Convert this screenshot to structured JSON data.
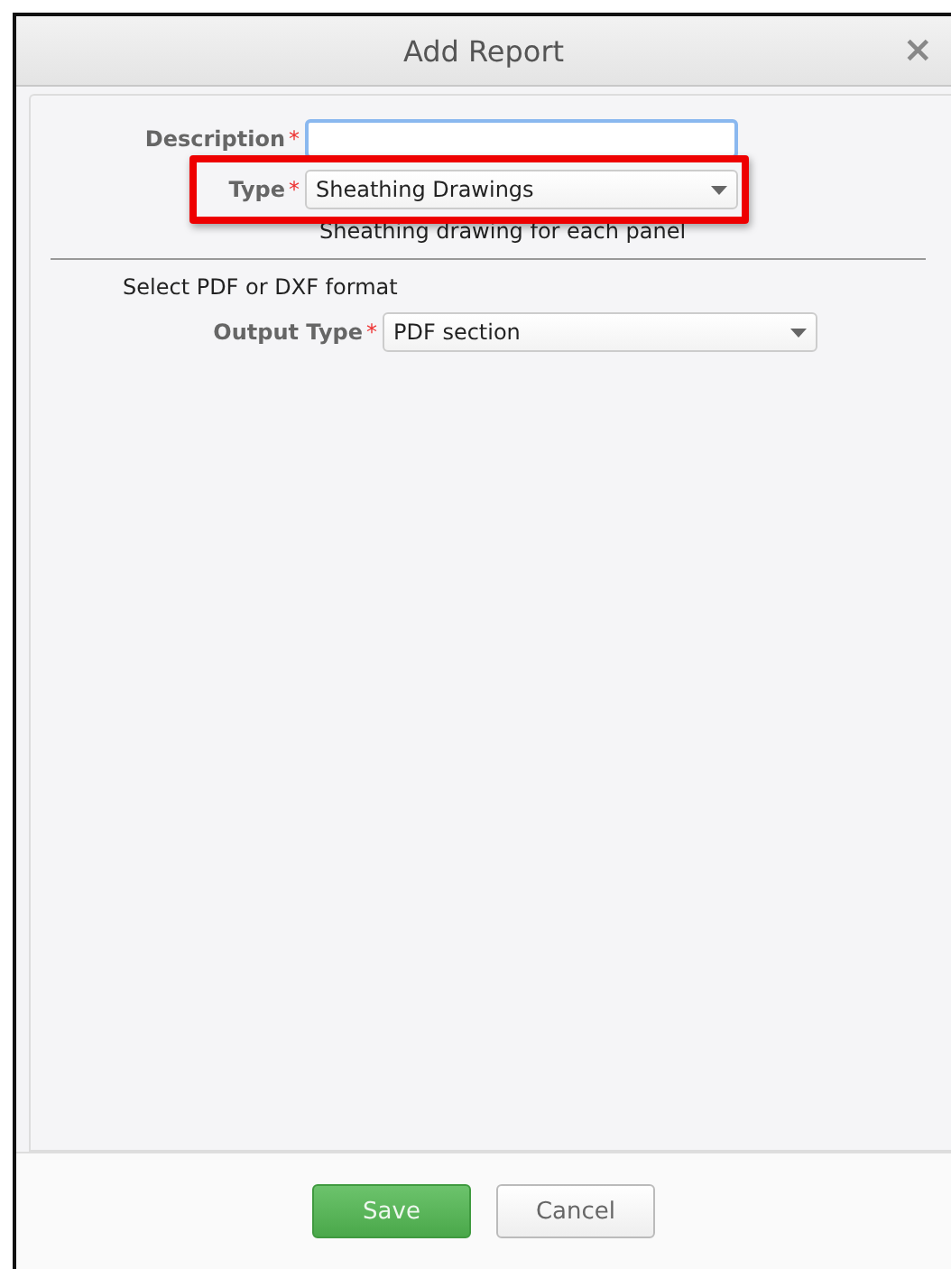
{
  "window": {
    "title": "Add Report",
    "close": "×"
  },
  "fields": [
    {
      "kind": "text",
      "label": "Description",
      "required": "*",
      "focused": true,
      "highlighted": false
    },
    {
      "kind": "select",
      "label": "Type",
      "required": "*",
      "value": "Sheathing Drawings",
      "focused": false,
      "highlighted": true,
      "hint": "Sheathing drawing for each panel"
    }
  ],
  "format_section": {
    "heading": "Select PDF or DXF format",
    "fields": [
      {
        "kind": "select",
        "label": "Output Type",
        "required": "*",
        "value": "PDF section",
        "focused": false,
        "highlighted": false
      }
    ]
  },
  "buttons": [
    {
      "label": "Save",
      "kind": "primary"
    },
    {
      "label": "Cancel",
      "kind": "secondary"
    }
  ]
}
